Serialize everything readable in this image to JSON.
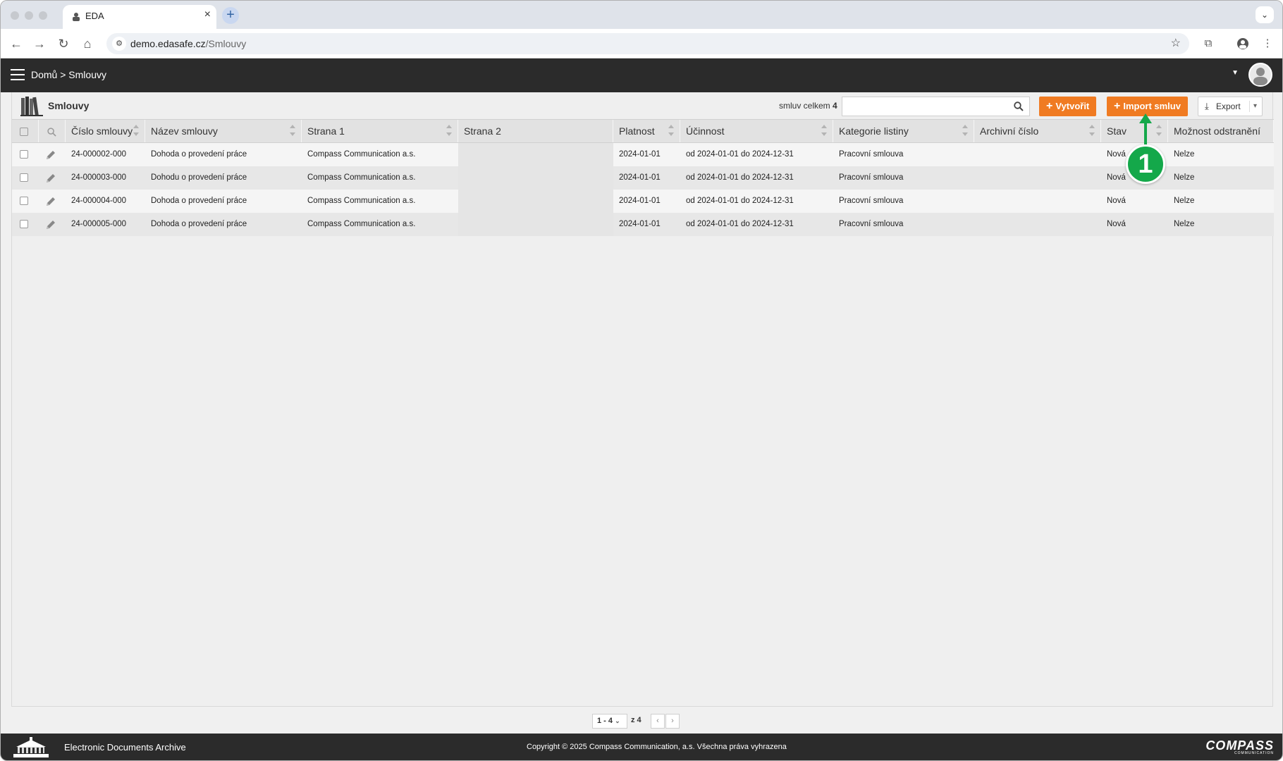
{
  "browser": {
    "tab_title": "EDA",
    "url_host": "demo.edasafe.cz",
    "url_path": "/Smlouvy"
  },
  "header": {
    "breadcrumb": "Domů > Smlouvy"
  },
  "page": {
    "title": "Smlouvy",
    "count_label": "smluv celkem",
    "count_value": "4",
    "search_value": "",
    "create_button": "Vytvořit",
    "import_button": "Import smluv",
    "export_button": "Export"
  },
  "table": {
    "columns": [
      "Číslo smlouvy",
      "Název smlouvy",
      "Strana 1",
      "Strana 2",
      "Platnost",
      "Účinnost",
      "Kategorie listiny",
      "Archivní číslo",
      "Stav",
      "Možnost odstranění"
    ],
    "rows": [
      {
        "cislo": "24-000002-000",
        "nazev": "Dohoda o provedení práce",
        "strana1": "Compass Communication a.s.",
        "strana2": "",
        "platnost": "2024-01-01",
        "ucinnost": "od 2024-01-01 do 2024-12-31",
        "kategorie": "Pracovní smlouva",
        "archivni": "",
        "stav": "Nová",
        "odstraneni": "Nelze"
      },
      {
        "cislo": "24-000003-000",
        "nazev": "Dohodu o provedení práce",
        "strana1": "Compass Communication a.s.",
        "strana2": "",
        "platnost": "2024-01-01",
        "ucinnost": "od 2024-01-01 do 2024-12-31",
        "kategorie": "Pracovní smlouva",
        "archivni": "",
        "stav": "Nová",
        "odstraneni": "Nelze"
      },
      {
        "cislo": "24-000004-000",
        "nazev": "Dohoda o provedení práce",
        "strana1": "Compass Communication a.s.",
        "strana2": "",
        "platnost": "2024-01-01",
        "ucinnost": "od 2024-01-01 do 2024-12-31",
        "kategorie": "Pracovní smlouva",
        "archivni": "",
        "stav": "Nová",
        "odstraneni": "Nelze"
      },
      {
        "cislo": "24-000005-000",
        "nazev": "Dohoda o provedení práce",
        "strana1": "Compass Communication a.s.",
        "strana2": "",
        "platnost": "2024-01-01",
        "ucinnost": "od 2024-01-01 do 2024-12-31",
        "kategorie": "Pracovní smlouva",
        "archivni": "",
        "stav": "Nová",
        "odstraneni": "Nelze"
      }
    ]
  },
  "pager": {
    "range": "1 - 4",
    "total": "z 4"
  },
  "footer": {
    "app_name": "Electronic Documents Archive",
    "copyright": "Copyright © 2025 Compass Communication, a.s. Všechna práva vyhrazena",
    "brand": "COMPASS",
    "brand_sub": "COMMUNICATION"
  },
  "callout": {
    "number": "1"
  },
  "colors": {
    "accent_orange": "#f07b22",
    "callout_green": "#14a84a",
    "header_dark": "#2b2b2b"
  },
  "icons": [
    "eda-favicon",
    "close-icon",
    "plus-icon",
    "back-icon",
    "forward-icon",
    "reload-icon",
    "home-icon",
    "site-settings-icon",
    "bookmark-star-icon",
    "extensions-icon",
    "profile-icon",
    "more-vert-icon",
    "hamburger-icon",
    "user-avatar-icon",
    "books-icon",
    "search-icon",
    "download-icon",
    "chevron-down-icon",
    "pencil-icon",
    "chevron-left-icon",
    "chevron-right-icon",
    "archive-building-icon"
  ]
}
